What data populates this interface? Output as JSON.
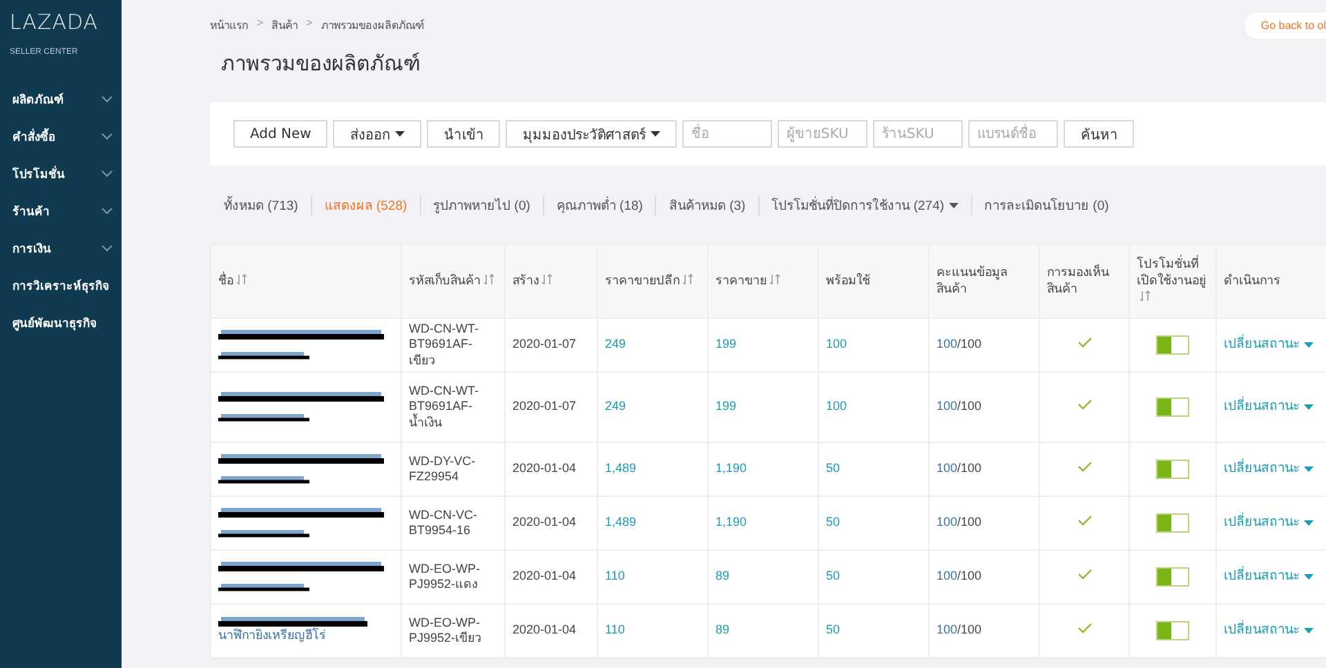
{
  "sidebar": {
    "logo": "LAZADA",
    "logo_sub": "SELLER CENTER",
    "items": [
      {
        "label": "ผลิตภัณฑ์",
        "expandable": true
      },
      {
        "label": "คำสั่งซื้อ",
        "expandable": true
      },
      {
        "label": "โปรโมชั่น",
        "expandable": true
      },
      {
        "label": "ร้านค้า",
        "expandable": true
      },
      {
        "label": "การเงิน",
        "expandable": true
      },
      {
        "label": "การวิเคราะห์ธุรกิจ",
        "expandable": false
      },
      {
        "label": "ศูนย์พัฒนาธุรกิจ",
        "expandable": false
      }
    ]
  },
  "breadcrumb": [
    "หน้าแรก",
    "สินค้า",
    "ภาพรวมของผลิตภัณฑ์"
  ],
  "breadcrumb_separator": ">",
  "go_back_button": "Go back to ol",
  "page_title": "ภาพรวมของผลิตภัณฑ์",
  "toolbar": {
    "items": [
      {
        "kind": "button",
        "label": "Add New"
      },
      {
        "kind": "dropdown",
        "label": "ส่งออก"
      },
      {
        "kind": "button",
        "label": "นำเข้า"
      },
      {
        "kind": "dropdown",
        "label": "มุมมองประวัติศาสตร์"
      },
      {
        "kind": "field",
        "placeholder": "ชื่อ"
      },
      {
        "kind": "field",
        "placeholder": "ผู้ขายSKU"
      },
      {
        "kind": "field",
        "placeholder": "ร้านSKU"
      },
      {
        "kind": "field",
        "placeholder": "แบรนด์ชื่อ"
      },
      {
        "kind": "button",
        "label": "ค้นหา"
      }
    ]
  },
  "tabs": [
    {
      "label": "ทั้งหมด (713)",
      "selected": false,
      "dropdown": false
    },
    {
      "label": "แสดงผล (528)",
      "selected": true,
      "dropdown": false
    },
    {
      "label": "รูปภาพหายไป (0)",
      "selected": false,
      "dropdown": false
    },
    {
      "label": "คุณภาพต่ำ (18)",
      "selected": false,
      "dropdown": false
    },
    {
      "label": "สินค้าหมด (3)",
      "selected": false,
      "dropdown": false
    },
    {
      "label": "โปรโมชั่นที่ปิดการใช้งาน (274)",
      "selected": false,
      "dropdown": true
    },
    {
      "label": "การละเมิดนโยบาย (0)",
      "selected": false,
      "dropdown": false
    }
  ],
  "table": {
    "columns": [
      {
        "label": "ชื่อ",
        "sortable": true
      },
      {
        "label": "รหัสเก็บสินค้า",
        "sortable": true
      },
      {
        "label": "สร้าง",
        "sortable": true
      },
      {
        "label": "ราคาขายปลีก",
        "sortable": true
      },
      {
        "label": "ราคาขาย",
        "sortable": true
      },
      {
        "label": "พร้อมใช้",
        "sortable": false
      },
      {
        "label": "คะแนนข้อมูลสินค้า",
        "sortable": false
      },
      {
        "label": "การมองเห็นสินค้า",
        "sortable": false
      },
      {
        "label": "โปรโมชั่นที่เปิดใช้งานอยู่",
        "sortable": true
      },
      {
        "label": "ดำเนินการ",
        "sortable": false
      }
    ],
    "rows": [
      {
        "name_redacted": true,
        "name": [],
        "sku": "WD-CN-WT-BT9691AF-เขียว",
        "created": "2020-01-07",
        "retail_price": "249",
        "price": "199",
        "available": "100",
        "score": "100",
        "score_suffix": "/100",
        "visible": true,
        "promo_on": true,
        "action": "เปลี่ยนสถานะ"
      },
      {
        "name_redacted": true,
        "name": [],
        "sku": "WD-CN-WT-BT9691AF-น้ำเงิน",
        "created": "2020-01-07",
        "retail_price": "249",
        "price": "199",
        "available": "100",
        "score": "100",
        "score_suffix": "/100",
        "visible": true,
        "promo_on": true,
        "action": "เปลี่ยนสถานะ"
      },
      {
        "name_redacted": true,
        "name": [],
        "sku": "WD-DY-VC-FZ29954",
        "created": "2020-01-04",
        "retail_price": "1,489",
        "price": "1,190",
        "available": "50",
        "score": "100",
        "score_suffix": "/100",
        "visible": true,
        "promo_on": true,
        "action": "เปลี่ยนสถานะ"
      },
      {
        "name_redacted": true,
        "name": [],
        "sku": "WD-CN-VC-BT9954-16",
        "created": "2020-01-04",
        "retail_price": "1,489",
        "price": "1,190",
        "available": "50",
        "score": "100",
        "score_suffix": "/100",
        "visible": true,
        "promo_on": true,
        "action": "เปลี่ยนสถานะ"
      },
      {
        "name_redacted": true,
        "name": [],
        "sku": "WD-EO-WP-PJ9952-แดง",
        "created": "2020-01-04",
        "retail_price": "110",
        "price": "89",
        "available": "50",
        "score": "100",
        "score_suffix": "/100",
        "visible": true,
        "promo_on": true,
        "action": "เปลี่ยนสถานะ"
      },
      {
        "name_redacted": true,
        "name": [
          "นาฬิกายิงเหรียญฮีโร่"
        ],
        "sku": "WD-EO-WP-PJ9952-เขียว",
        "created": "2020-01-04",
        "retail_price": "110",
        "price": "89",
        "available": "50",
        "score": "100",
        "score_suffix": "/100",
        "visible": true,
        "promo_on": true,
        "action": "เปลี่ยนสถานะ"
      }
    ]
  }
}
